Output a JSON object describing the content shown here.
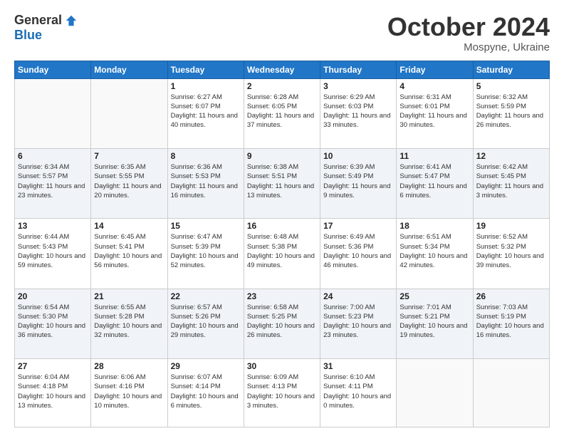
{
  "header": {
    "logo": {
      "general": "General",
      "blue": "Blue"
    },
    "title": "October 2024",
    "subtitle": "Mospyne, Ukraine"
  },
  "weekdays": [
    "Sunday",
    "Monday",
    "Tuesday",
    "Wednesday",
    "Thursday",
    "Friday",
    "Saturday"
  ],
  "weeks": [
    [
      {
        "day": "",
        "sunrise": "",
        "sunset": "",
        "daylight": ""
      },
      {
        "day": "",
        "sunrise": "",
        "sunset": "",
        "daylight": ""
      },
      {
        "day": "1",
        "sunrise": "Sunrise: 6:27 AM",
        "sunset": "Sunset: 6:07 PM",
        "daylight": "Daylight: 11 hours and 40 minutes."
      },
      {
        "day": "2",
        "sunrise": "Sunrise: 6:28 AM",
        "sunset": "Sunset: 6:05 PM",
        "daylight": "Daylight: 11 hours and 37 minutes."
      },
      {
        "day": "3",
        "sunrise": "Sunrise: 6:29 AM",
        "sunset": "Sunset: 6:03 PM",
        "daylight": "Daylight: 11 hours and 33 minutes."
      },
      {
        "day": "4",
        "sunrise": "Sunrise: 6:31 AM",
        "sunset": "Sunset: 6:01 PM",
        "daylight": "Daylight: 11 hours and 30 minutes."
      },
      {
        "day": "5",
        "sunrise": "Sunrise: 6:32 AM",
        "sunset": "Sunset: 5:59 PM",
        "daylight": "Daylight: 11 hours and 26 minutes."
      }
    ],
    [
      {
        "day": "6",
        "sunrise": "Sunrise: 6:34 AM",
        "sunset": "Sunset: 5:57 PM",
        "daylight": "Daylight: 11 hours and 23 minutes."
      },
      {
        "day": "7",
        "sunrise": "Sunrise: 6:35 AM",
        "sunset": "Sunset: 5:55 PM",
        "daylight": "Daylight: 11 hours and 20 minutes."
      },
      {
        "day": "8",
        "sunrise": "Sunrise: 6:36 AM",
        "sunset": "Sunset: 5:53 PM",
        "daylight": "Daylight: 11 hours and 16 minutes."
      },
      {
        "day": "9",
        "sunrise": "Sunrise: 6:38 AM",
        "sunset": "Sunset: 5:51 PM",
        "daylight": "Daylight: 11 hours and 13 minutes."
      },
      {
        "day": "10",
        "sunrise": "Sunrise: 6:39 AM",
        "sunset": "Sunset: 5:49 PM",
        "daylight": "Daylight: 11 hours and 9 minutes."
      },
      {
        "day": "11",
        "sunrise": "Sunrise: 6:41 AM",
        "sunset": "Sunset: 5:47 PM",
        "daylight": "Daylight: 11 hours and 6 minutes."
      },
      {
        "day": "12",
        "sunrise": "Sunrise: 6:42 AM",
        "sunset": "Sunset: 5:45 PM",
        "daylight": "Daylight: 11 hours and 3 minutes."
      }
    ],
    [
      {
        "day": "13",
        "sunrise": "Sunrise: 6:44 AM",
        "sunset": "Sunset: 5:43 PM",
        "daylight": "Daylight: 10 hours and 59 minutes."
      },
      {
        "day": "14",
        "sunrise": "Sunrise: 6:45 AM",
        "sunset": "Sunset: 5:41 PM",
        "daylight": "Daylight: 10 hours and 56 minutes."
      },
      {
        "day": "15",
        "sunrise": "Sunrise: 6:47 AM",
        "sunset": "Sunset: 5:39 PM",
        "daylight": "Daylight: 10 hours and 52 minutes."
      },
      {
        "day": "16",
        "sunrise": "Sunrise: 6:48 AM",
        "sunset": "Sunset: 5:38 PM",
        "daylight": "Daylight: 10 hours and 49 minutes."
      },
      {
        "day": "17",
        "sunrise": "Sunrise: 6:49 AM",
        "sunset": "Sunset: 5:36 PM",
        "daylight": "Daylight: 10 hours and 46 minutes."
      },
      {
        "day": "18",
        "sunrise": "Sunrise: 6:51 AM",
        "sunset": "Sunset: 5:34 PM",
        "daylight": "Daylight: 10 hours and 42 minutes."
      },
      {
        "day": "19",
        "sunrise": "Sunrise: 6:52 AM",
        "sunset": "Sunset: 5:32 PM",
        "daylight": "Daylight: 10 hours and 39 minutes."
      }
    ],
    [
      {
        "day": "20",
        "sunrise": "Sunrise: 6:54 AM",
        "sunset": "Sunset: 5:30 PM",
        "daylight": "Daylight: 10 hours and 36 minutes."
      },
      {
        "day": "21",
        "sunrise": "Sunrise: 6:55 AM",
        "sunset": "Sunset: 5:28 PM",
        "daylight": "Daylight: 10 hours and 32 minutes."
      },
      {
        "day": "22",
        "sunrise": "Sunrise: 6:57 AM",
        "sunset": "Sunset: 5:26 PM",
        "daylight": "Daylight: 10 hours and 29 minutes."
      },
      {
        "day": "23",
        "sunrise": "Sunrise: 6:58 AM",
        "sunset": "Sunset: 5:25 PM",
        "daylight": "Daylight: 10 hours and 26 minutes."
      },
      {
        "day": "24",
        "sunrise": "Sunrise: 7:00 AM",
        "sunset": "Sunset: 5:23 PM",
        "daylight": "Daylight: 10 hours and 23 minutes."
      },
      {
        "day": "25",
        "sunrise": "Sunrise: 7:01 AM",
        "sunset": "Sunset: 5:21 PM",
        "daylight": "Daylight: 10 hours and 19 minutes."
      },
      {
        "day": "26",
        "sunrise": "Sunrise: 7:03 AM",
        "sunset": "Sunset: 5:19 PM",
        "daylight": "Daylight: 10 hours and 16 minutes."
      }
    ],
    [
      {
        "day": "27",
        "sunrise": "Sunrise: 6:04 AM",
        "sunset": "Sunset: 4:18 PM",
        "daylight": "Daylight: 10 hours and 13 minutes."
      },
      {
        "day": "28",
        "sunrise": "Sunrise: 6:06 AM",
        "sunset": "Sunset: 4:16 PM",
        "daylight": "Daylight: 10 hours and 10 minutes."
      },
      {
        "day": "29",
        "sunrise": "Sunrise: 6:07 AM",
        "sunset": "Sunset: 4:14 PM",
        "daylight": "Daylight: 10 hours and 6 minutes."
      },
      {
        "day": "30",
        "sunrise": "Sunrise: 6:09 AM",
        "sunset": "Sunset: 4:13 PM",
        "daylight": "Daylight: 10 hours and 3 minutes."
      },
      {
        "day": "31",
        "sunrise": "Sunrise: 6:10 AM",
        "sunset": "Sunset: 4:11 PM",
        "daylight": "Daylight: 10 hours and 0 minutes."
      },
      {
        "day": "",
        "sunrise": "",
        "sunset": "",
        "daylight": ""
      },
      {
        "day": "",
        "sunrise": "",
        "sunset": "",
        "daylight": ""
      }
    ]
  ]
}
